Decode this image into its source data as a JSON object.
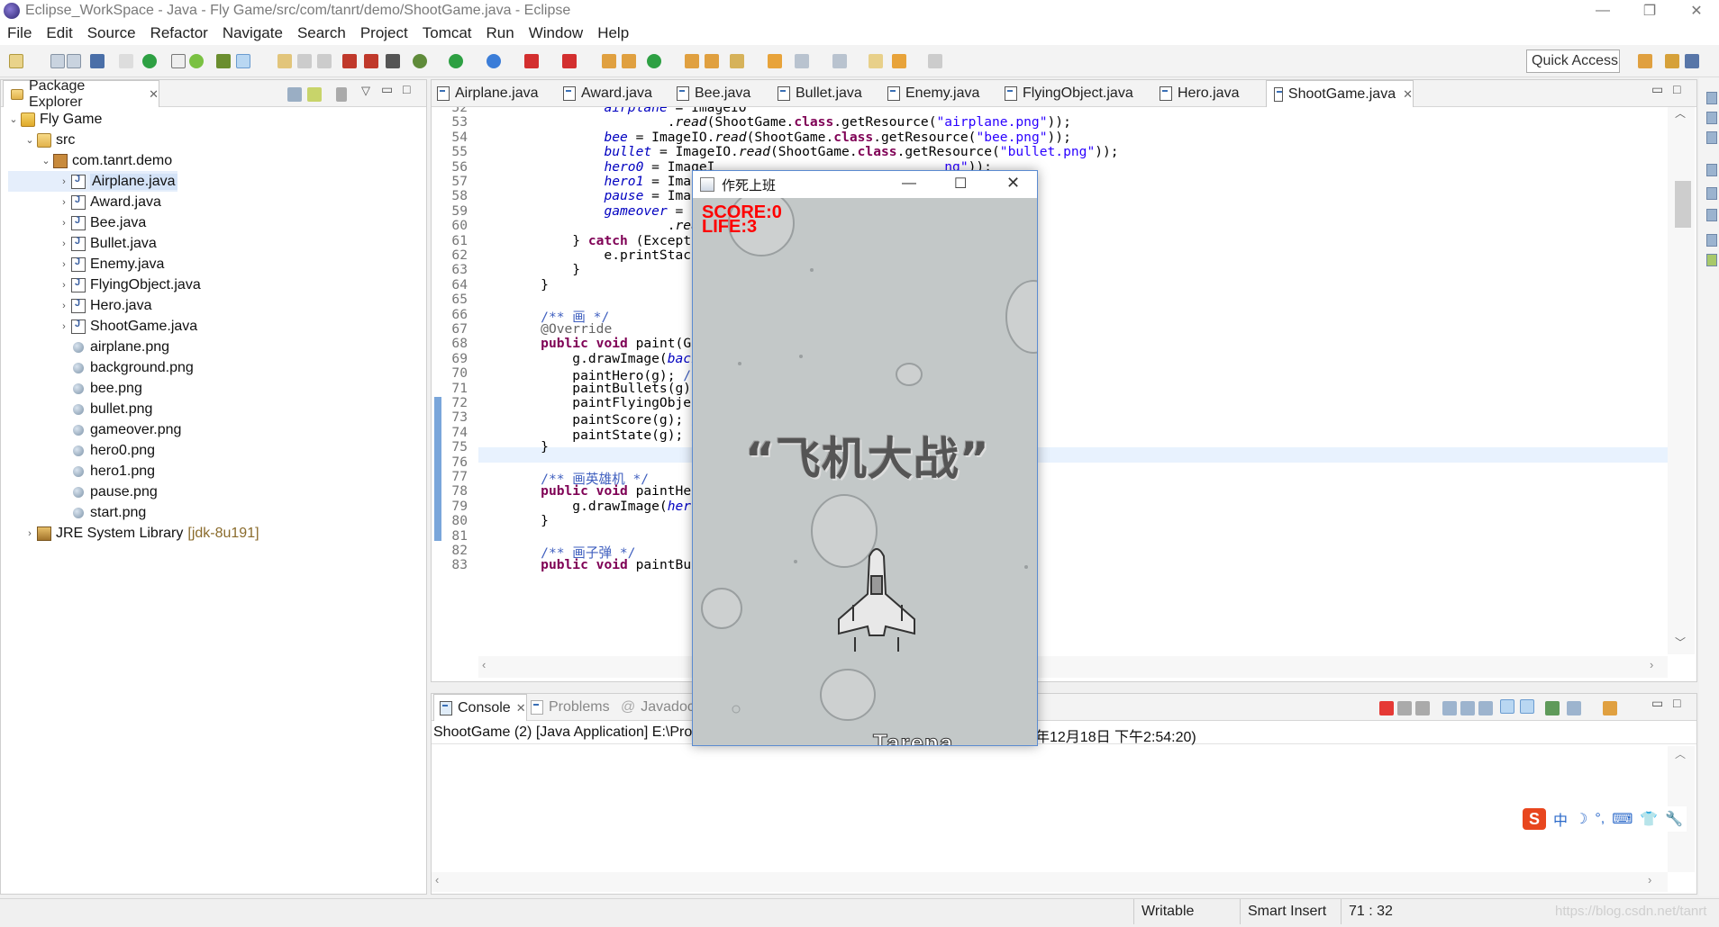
{
  "window": {
    "title": "Eclipse_WorkSpace - Java - Fly Game/src/com/tanrt/demo/ShootGame.java - Eclipse",
    "controls": [
      "—",
      "❐",
      "✕"
    ]
  },
  "menu": [
    "File",
    "Edit",
    "Source",
    "Refactor",
    "Navigate",
    "Search",
    "Project",
    "Tomcat",
    "Run",
    "Window",
    "Help"
  ],
  "quick_access": "Quick Access",
  "package_explorer": {
    "title": "Package Explorer",
    "tree": [
      {
        "label": "Fly Game",
        "type": "project",
        "depth": 0,
        "arrow": "⌄"
      },
      {
        "label": "src",
        "type": "folder",
        "depth": 1,
        "arrow": "⌄"
      },
      {
        "label": "com.tanrt.demo",
        "type": "package",
        "depth": 2,
        "arrow": "⌄"
      },
      {
        "label": "Airplane.java",
        "type": "java",
        "depth": 3,
        "arrow": "›",
        "selected": true
      },
      {
        "label": "Award.java",
        "type": "java",
        "depth": 3,
        "arrow": "›"
      },
      {
        "label": "Bee.java",
        "type": "java",
        "depth": 3,
        "arrow": "›"
      },
      {
        "label": "Bullet.java",
        "type": "java",
        "depth": 3,
        "arrow": "›"
      },
      {
        "label": "Enemy.java",
        "type": "java",
        "depth": 3,
        "arrow": "›"
      },
      {
        "label": "FlyingObject.java",
        "type": "java",
        "depth": 3,
        "arrow": "›"
      },
      {
        "label": "Hero.java",
        "type": "java",
        "depth": 3,
        "arrow": "›"
      },
      {
        "label": "ShootGame.java",
        "type": "java",
        "depth": 3,
        "arrow": "›"
      },
      {
        "label": "airplane.png",
        "type": "png",
        "depth": 3,
        "arrow": ""
      },
      {
        "label": "background.png",
        "type": "png",
        "depth": 3,
        "arrow": ""
      },
      {
        "label": "bee.png",
        "type": "png",
        "depth": 3,
        "arrow": ""
      },
      {
        "label": "bullet.png",
        "type": "png",
        "depth": 3,
        "arrow": ""
      },
      {
        "label": "gameover.png",
        "type": "png",
        "depth": 3,
        "arrow": ""
      },
      {
        "label": "hero0.png",
        "type": "png",
        "depth": 3,
        "arrow": ""
      },
      {
        "label": "hero1.png",
        "type": "png",
        "depth": 3,
        "arrow": ""
      },
      {
        "label": "pause.png",
        "type": "png",
        "depth": 3,
        "arrow": ""
      },
      {
        "label": "start.png",
        "type": "png",
        "depth": 3,
        "arrow": ""
      },
      {
        "label": "JRE System Library",
        "type": "lib",
        "depth": 1,
        "arrow": "›",
        "suffix": "[jdk-8u191]"
      }
    ]
  },
  "editor": {
    "tabs": [
      "Airplane.java",
      "Award.java",
      "Bee.java",
      "Bullet.java",
      "Enemy.java",
      "FlyingObject.java",
      "Hero.java",
      "ShootGame.java"
    ],
    "active_tab": "ShootGame.java",
    "lines": [
      {
        "n": "52",
        "html": "            <span class=\"fld\">airplane</span> = ImageIO"
      },
      {
        "n": "53",
        "html": "                    .<span class=\"italic\">read</span>(ShootGame.<span class=\"kw\">class</span>.getResource(<span class=\"str\">\"airplane.png\"</span>));"
      },
      {
        "n": "54",
        "html": "            <span class=\"fld\">bee</span> = ImageIO.<span class=\"italic\">read</span>(ShootGame.<span class=\"kw\">class</span>.getResource(<span class=\"str\">\"bee.png\"</span>));"
      },
      {
        "n": "55",
        "html": "            <span class=\"fld\">bullet</span> = ImageIO.<span class=\"italic\">read</span>(ShootGame.<span class=\"kw\">class</span>.getResource(<span class=\"str\">\"bullet.png\"</span>));"
      },
      {
        "n": "56",
        "html": "            <span class=\"fld\">hero0</span> = ImageI                             <span class=\"str\">ng\"</span>));"
      },
      {
        "n": "57",
        "html": "            <span class=\"fld\">hero1</span> = ImageI                             <span class=\"str\">ng\"</span>));"
      },
      {
        "n": "58",
        "html": "            <span class=\"fld\">pause</span> = ImageI                              <span class=\"str\">ng\"</span>));"
      },
      {
        "n": "59",
        "html": "            <span class=\"fld\">gameover</span> = Imag"
      },
      {
        "n": "60",
        "html": "                    .<span class=\"italic\">read</span>(                                   );"
      },
      {
        "n": "61",
        "html": "        } <span class=\"kw\">catch</span> (Exception"
      },
      {
        "n": "62",
        "html": "            e.printStackTra"
      },
      {
        "n": "63",
        "html": "        }"
      },
      {
        "n": "64",
        "html": "    }"
      },
      {
        "n": "65",
        "html": ""
      },
      {
        "n": "66",
        "html": "    <span class=\"cm\">/** 画 */</span>"
      },
      {
        "n": "67",
        "html": "    <span class=\"ann\">@Override</span>"
      },
      {
        "n": "68",
        "html": "    <span class=\"kw\">public void</span> paint(Graph"
      },
      {
        "n": "69",
        "html": "        g.drawImage(<span class=\"fld\">backgro</span>"
      },
      {
        "n": "70",
        "html": "        paintHero(g); <span class=\"cm\">// 画</span>"
      },
      {
        "n": "71",
        "html": "        paintBullets(g); <span class=\"cm\">//</span>"
      },
      {
        "n": "72",
        "html": "        paintFlyingObjects("
      },
      {
        "n": "73",
        "html": "        paintScore(g); <span class=\"cm\">// 画</span>"
      },
      {
        "n": "74",
        "html": "        paintState(g); <span class=\"cm\">// 画</span>"
      },
      {
        "n": "75",
        "html": "    }"
      },
      {
        "n": "76",
        "html": ""
      },
      {
        "n": "77",
        "html": "    <span class=\"cm\">/** 画英雄机 */</span>"
      },
      {
        "n": "78",
        "html": "    <span class=\"kw\">public void</span> paintHero(G"
      },
      {
        "n": "79",
        "html": "        g.drawImage(<span class=\"fld\">hero</span>.ge"
      },
      {
        "n": "80",
        "html": "    }"
      },
      {
        "n": "81",
        "html": ""
      },
      {
        "n": "82",
        "html": "    <span class=\"cm\">/** 画子弹 */</span>"
      },
      {
        "n": "83",
        "html": "    <span class=\"kw\">public void</span> paintBullet"
      }
    ]
  },
  "console": {
    "tabs": [
      "Console",
      "Problems",
      "Javadoc"
    ],
    "launch_left": "ShootGame (2) [Java Application] E:\\Pro",
    "launch_right": "年12月18日 下午2:54:20)"
  },
  "status": {
    "writable": "Writable",
    "insert_mode": "Smart Insert",
    "position": "71 : 32",
    "watermark": "https://blog.csdn.net/tanrt"
  },
  "game": {
    "title": "作死上班",
    "score_label": "SCORE:0",
    "life_label": "LIFE:3",
    "banner": "“飞机大战”",
    "logo_text": "Tarena",
    "controls": [
      "—",
      "☐",
      "✕"
    ]
  },
  "ime": {
    "items": [
      "中",
      "☽",
      "°,",
      "⌨",
      "👕",
      "⇧",
      "🔧"
    ]
  },
  "colors": {
    "score_red": "#ff0000",
    "editor_keyword": "#7f0055",
    "editor_string": "#2a00ff",
    "editor_field": "#0000c0",
    "editor_comment": "#3f5fbf"
  }
}
